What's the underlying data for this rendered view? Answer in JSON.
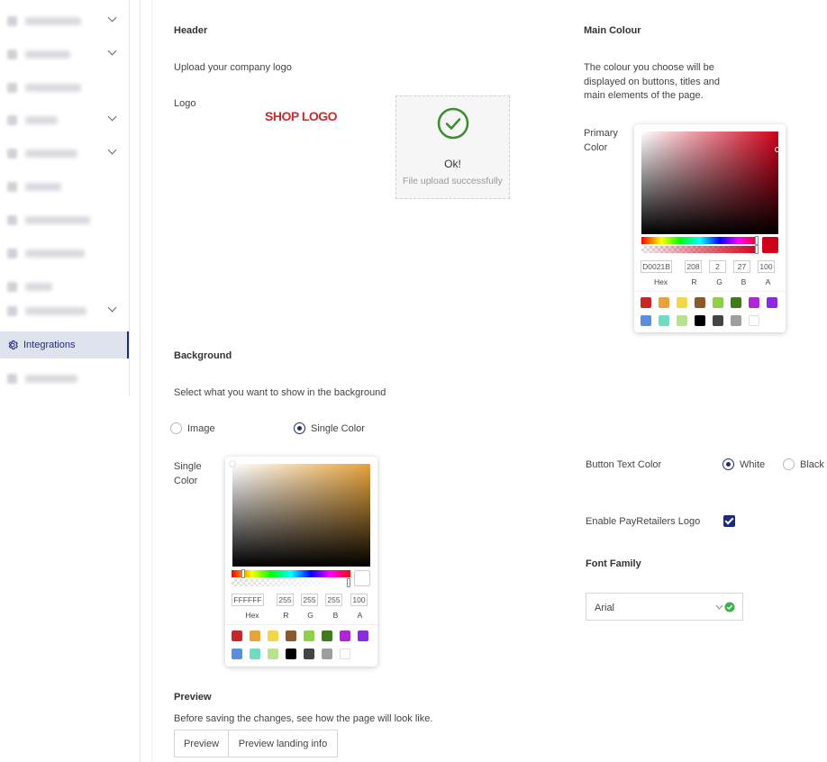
{
  "sidebar": {
    "items": [
      {
        "blurred": true,
        "chevron": true
      },
      {
        "blurred": true,
        "chevron": true
      },
      {
        "blurred": true,
        "chevron": false
      },
      {
        "blurred": true,
        "chevron": true
      },
      {
        "blurred": true,
        "chevron": true
      },
      {
        "blurred": true,
        "chevron": false
      },
      {
        "blurred": true,
        "chevron": false
      },
      {
        "blurred": true,
        "chevron": false
      },
      {
        "blurred": true,
        "chevron": false
      },
      {
        "blurred": true,
        "chevron": true
      },
      {
        "label": "Integrations",
        "icon": "gear-icon",
        "active": true
      },
      {
        "blurred": true,
        "chevron": false
      }
    ]
  },
  "header": {
    "title": "Header",
    "description": "Upload your company logo",
    "logo_label": "Logo",
    "logo_text": "SHOP LOGO",
    "upload_status": "Ok!",
    "upload_message": "File upload successfully"
  },
  "main_colour": {
    "title": "Main Colour",
    "description": "The colour you choose will be displayed on buttons, titles and main elements of the page.",
    "primary_label": "Primary Color",
    "picker": {
      "hex": "D0021B",
      "r": "208",
      "g": "2",
      "b": "27",
      "a": "100",
      "labels": {
        "hex": "Hex",
        "r": "R",
        "g": "G",
        "b": "B",
        "a": "A"
      },
      "current_color": "#d0021b"
    }
  },
  "background": {
    "title": "Background",
    "description": "Select what you want to show in the background",
    "options": [
      {
        "label": "Image",
        "selected": false
      },
      {
        "label": "Single Color",
        "selected": true
      }
    ],
    "single_color_label": "Single Color",
    "picker": {
      "hex": "FFFFFF",
      "r": "255",
      "g": "255",
      "b": "255",
      "a": "100",
      "labels": {
        "hex": "Hex",
        "r": "R",
        "g": "G",
        "b": "B",
        "a": "A"
      },
      "current_color": "#ffffff"
    }
  },
  "swatches": [
    "#c62828",
    "#e8a33c",
    "#f2d74b",
    "#8b5a2b",
    "#8ed04a",
    "#417a1c",
    "#b026d6",
    "#8a2be2",
    "#5b8fdd",
    "#6fdcc3",
    "#b7e391",
    "#000000",
    "#444444",
    "#9e9e9e",
    "#ffffff"
  ],
  "button_text_color": {
    "label": "Button Text Color",
    "options": [
      {
        "label": "White",
        "selected": true
      },
      {
        "label": "Black",
        "selected": false
      }
    ]
  },
  "payretailers_logo": {
    "label": "Enable PayRetailers Logo",
    "checked": true
  },
  "font_family": {
    "title": "Font Family",
    "value": "Arial"
  },
  "preview": {
    "title": "Preview",
    "description": "Before saving the changes, see how the page will look like.",
    "buttons": [
      "Preview",
      "Preview landing info"
    ]
  }
}
